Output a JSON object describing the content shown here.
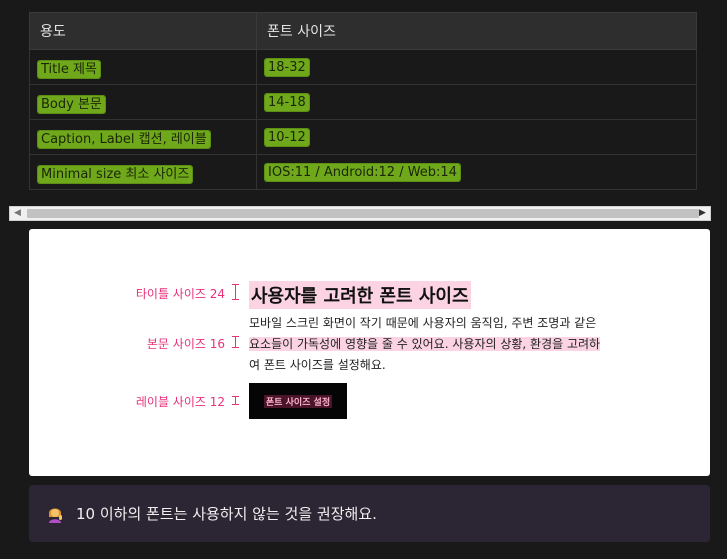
{
  "table": {
    "headers": [
      "용도",
      "폰트 사이즈"
    ],
    "rows": [
      {
        "usage": "Title 제목",
        "size": "18-32"
      },
      {
        "usage": "Body 본문",
        "size": "14-18"
      },
      {
        "usage": "Caption, Label 캡션, 레이블",
        "size": "10-12"
      },
      {
        "usage": "Minimal size 최소 사이즈",
        "size": "IOS:11 / Android:12 / Web:14"
      }
    ],
    "highlight_color": "#6fa81b"
  },
  "illustration": {
    "labels": {
      "title": "타이틀 사이즈 24",
      "body": "본문 사이즈 16",
      "label": "레이블 사이즈 12"
    },
    "title_text": "사용자를 고려한 폰트 사이즈",
    "body_lines": [
      "모바일 스크린 화면이 작기 때문에 사용자의 움직임, 주변 조명과 같은",
      "요소들이 가독성에 영향을 줄 수 있어요. 사용자의 상황, 환경을 고려하",
      "여 폰트 사이즈를 설정해요."
    ],
    "button_label": "폰트 사이즈 설정",
    "accent_color": "#e8317a"
  },
  "callout": {
    "icon": "person-tipping-hand-icon",
    "text": "10 이하의 폰트는 사용하지 않는 것을 권장해요."
  }
}
